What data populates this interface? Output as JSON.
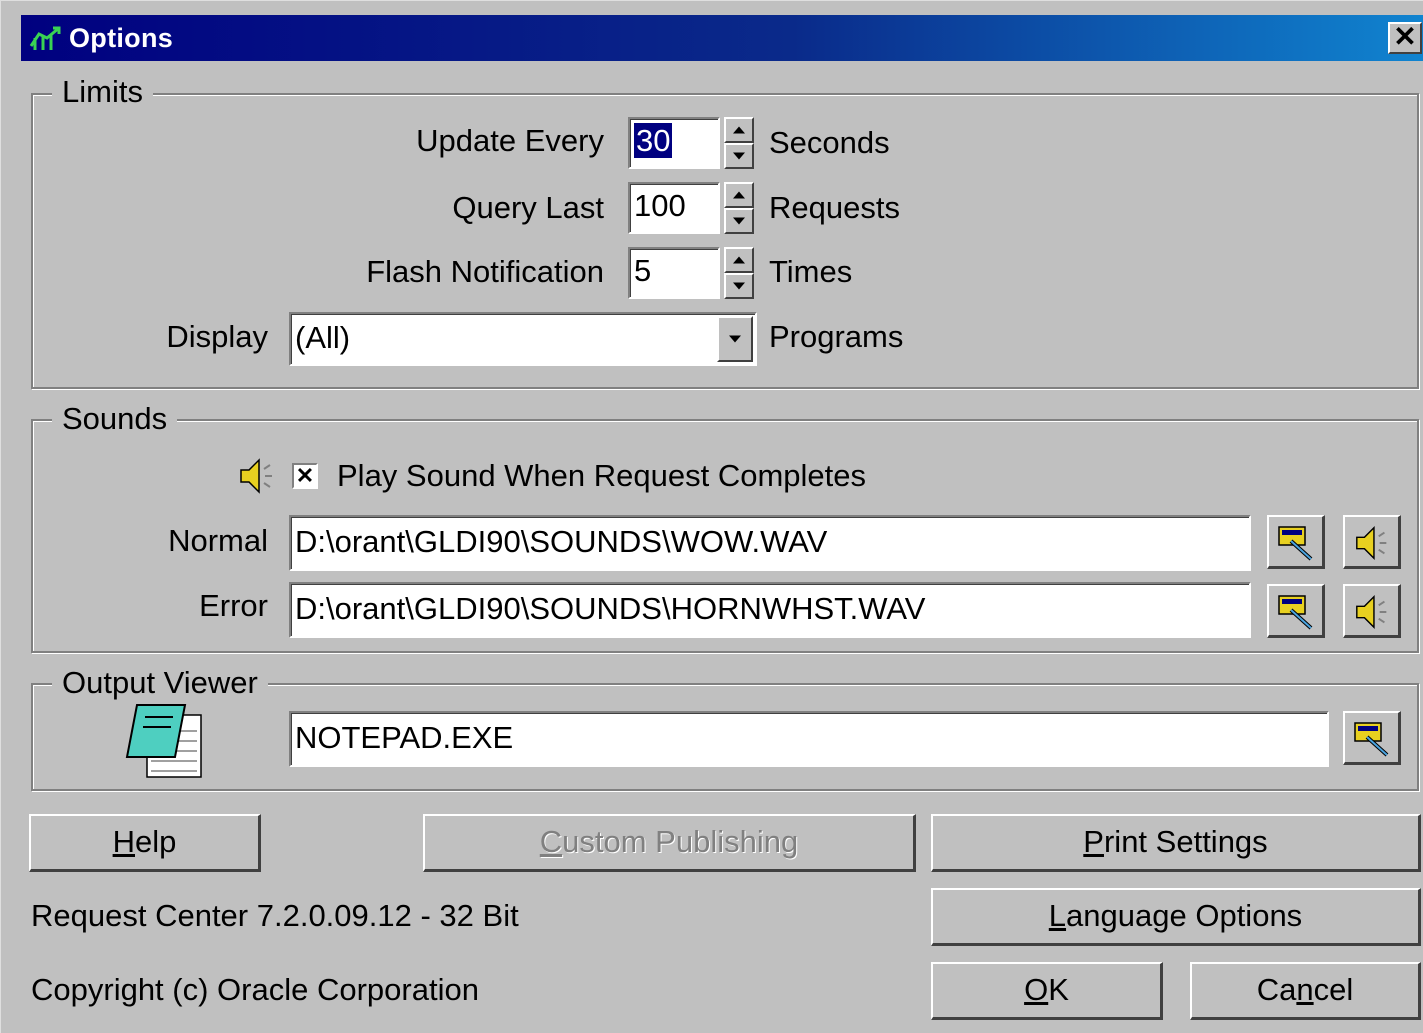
{
  "window": {
    "title": "Options",
    "close_label": "✕"
  },
  "limits": {
    "legend": "Limits",
    "update_every": {
      "label": "Update Every",
      "value": "30",
      "unit": "Seconds"
    },
    "query_last": {
      "label": "Query Last",
      "value": "100",
      "unit": "Requests"
    },
    "flash_notification": {
      "label": "Flash Notification",
      "value": "5",
      "unit": "Times"
    },
    "display": {
      "label": "Display",
      "value": "(All)",
      "unit": "Programs"
    }
  },
  "sounds": {
    "legend": "Sounds",
    "play_sound_label": "Play Sound When Request Completes",
    "play_sound_checked": true,
    "normal": {
      "label": "Normal",
      "value": "D:\\orant\\GLDI90\\SOUNDS\\WOW.WAV"
    },
    "error": {
      "label": "Error",
      "value": "D:\\orant\\GLDI90\\SOUNDS\\HORNWHST.WAV"
    }
  },
  "output_viewer": {
    "legend": "Output Viewer",
    "value": "NOTEPAD.EXE"
  },
  "buttons": {
    "help": {
      "hotkey": "H",
      "rest": "elp"
    },
    "custom_publishing": {
      "hotkey": "C",
      "rest": "ustom Publishing"
    },
    "print_settings": {
      "hotkey": "P",
      "rest": "rint Settings"
    },
    "language_options": {
      "hotkey": "L",
      "rest": "anguage Options"
    },
    "ok": {
      "hotkey": "O",
      "rest": "K"
    },
    "cancel": {
      "pre": "Ca",
      "hotkey": "n",
      "rest": "cel"
    }
  },
  "footer": {
    "version": "Request Center 7.2.0.09.12 - 32 Bit",
    "copyright": "Copyright (c) Oracle Corporation"
  },
  "colors": {
    "titlebar_start": "#000080",
    "titlebar_end": "#1084d0",
    "face": "#c0c0c0"
  }
}
